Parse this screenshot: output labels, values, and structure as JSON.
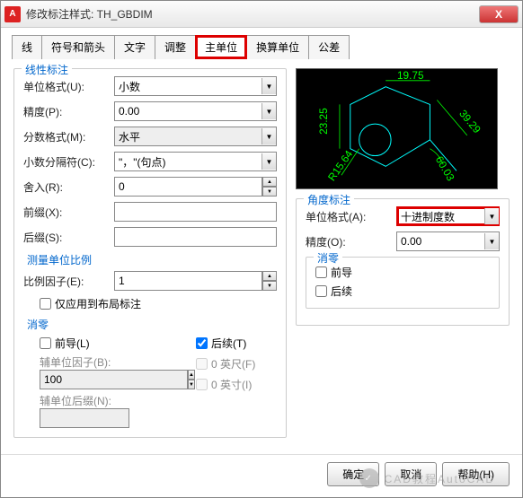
{
  "window": {
    "title": "修改标注样式: TH_GBDIM"
  },
  "tabs": {
    "items": [
      "线",
      "符号和箭头",
      "文字",
      "调整",
      "主单位",
      "换算单位",
      "公差"
    ],
    "active_index": 4
  },
  "linear": {
    "group_title": "线性标注",
    "format_label": "单位格式(U):",
    "format_value": "小数",
    "precision_label": "精度(P):",
    "precision_value": "0.00",
    "fraction_label": "分数格式(M):",
    "fraction_value": "水平",
    "decimal_sep_label": "小数分隔符(C):",
    "decimal_sep_value": "\"，\"(句点)",
    "round_label": "舍入(R):",
    "round_value": "0",
    "prefix_label": "前缀(X):",
    "prefix_value": "",
    "suffix_label": "后缀(S):",
    "suffix_value": ""
  },
  "scale": {
    "group_title": "测量单位比例",
    "factor_label": "比例因子(E):",
    "factor_value": "1",
    "layout_only_label": "仅应用到布局标注"
  },
  "zero": {
    "group_title": "消零",
    "leading_label": "前导(L)",
    "trailing_label": "后续(T)",
    "trailing_checked": true,
    "aux_factor_label": "辅单位因子(B):",
    "aux_factor_value": "100",
    "aux_suffix_label": "辅单位后缀(N):",
    "aux_suffix_value": "",
    "feet_label": "0 英尺(F)",
    "inches_label": "0 英寸(I)"
  },
  "angle": {
    "group_title": "角度标注",
    "format_label": "单位格式(A):",
    "format_value": "十进制度数",
    "precision_label": "精度(O):",
    "precision_value": "0.00",
    "zero_title": "消零",
    "leading_label": "前导",
    "trailing_label": "后续"
  },
  "preview": {
    "dim1": "19.75",
    "dim2": "23.25",
    "dim3": "39.29",
    "dim4": "60.03",
    "dim5": "R15.64"
  },
  "footer": {
    "ok": "确定",
    "cancel": "取消",
    "help": "帮助(H)"
  },
  "watermark": "CAD教程AutoCAD"
}
